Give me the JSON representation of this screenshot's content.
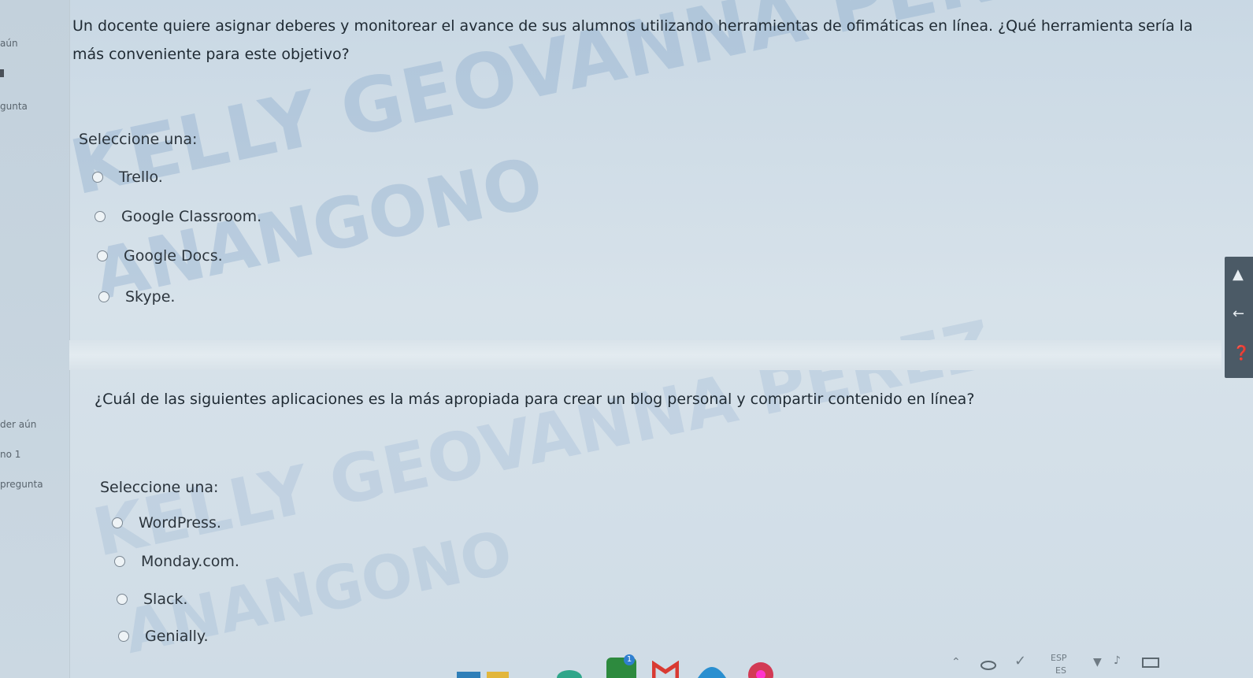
{
  "sidebar": {
    "texts": [
      "aún",
      "gunta",
      "der aún",
      "no 1",
      "pregunta"
    ]
  },
  "question1": {
    "text_line1": "Un docente quiere asignar deberes y monitorear el avance de sus alumnos utilizando herramientas de ofimáticas en línea. ¿Qué herramienta sería la",
    "text_line2": "más conveniente para este objetivo?",
    "select_label": "Seleccione una:",
    "options": [
      "Trello.",
      "Google Classroom.",
      "Google Docs.",
      "Skype."
    ]
  },
  "question2": {
    "text": "¿Cuál de las siguientes aplicaciones es la más apropiada para crear un blog personal y compartir contenido en línea?",
    "select_label": "Seleccione una:",
    "options": [
      "WordPress.",
      "Monday.com.",
      "Slack.",
      "Genially."
    ]
  },
  "watermark": {
    "line1": "KELLY GEOVANNA PEREZ",
    "line2": "ANANGONO"
  },
  "tray": {
    "language_top": "ESP",
    "language_bottom": "ES",
    "notification_count": "1"
  },
  "colors": {
    "accent": "#4b5a66",
    "watermark": "#6e96c3"
  },
  "icons": {
    "side_tools": [
      "pin-icon",
      "back-arrow-icon",
      "help-icon"
    ],
    "tray": [
      "chevron-up-icon",
      "cloud-icon",
      "pen-icon",
      "wifi-icon",
      "volume-icon",
      "battery-icon"
    ]
  }
}
